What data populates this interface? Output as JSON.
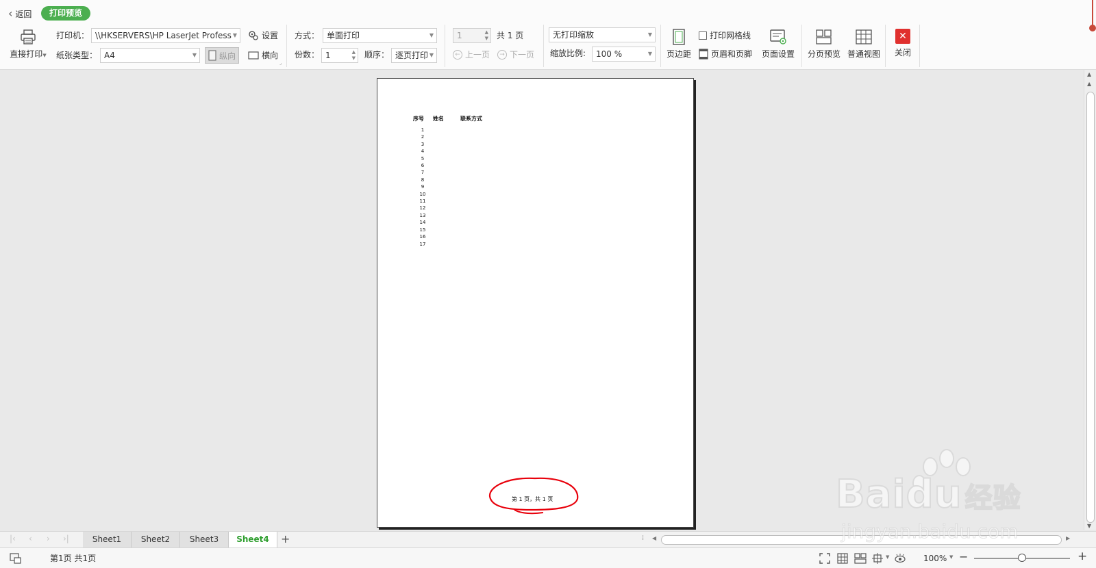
{
  "nav": {
    "back_label": "返回",
    "mode_badge": "打印预览"
  },
  "ribbon": {
    "direct_print_label": "直接打印",
    "printer_label": "打印机：",
    "printer_value": "\\\\HKSERVERS\\HP LaserJet Profess",
    "settings_label": "设置",
    "paper_type_label": "纸张类型：",
    "paper_type_value": "A4",
    "portrait_label": "纵向",
    "landscape_label": "横向",
    "method_label": "方式：",
    "method_value": "单面打印",
    "copies_label": "份数：",
    "copies_value": "1",
    "order_label": "顺序：",
    "order_value": "逐页打印",
    "page_input_value": "1",
    "total_pages_label": "共 1 页",
    "prev_page_label": "上一页",
    "next_page_label": "下一页",
    "scale_mode_value": "无打印缩放",
    "scale_ratio_label": "缩放比例:",
    "scale_ratio_value": "100 %",
    "margins_label": "页边距",
    "print_gridlines_label": "打印网格线",
    "header_footer_label": "页眉和页脚",
    "page_setup_label": "页面设置",
    "page_break_preview_label": "分页预览",
    "normal_view_label": "普通视图",
    "close_label": "关闭"
  },
  "page": {
    "headers": [
      "序号",
      "姓名",
      "联系方式"
    ],
    "row_numbers": [
      "1",
      "2",
      "3",
      "4",
      "5",
      "6",
      "7",
      "8",
      "9",
      "10",
      "11",
      "12",
      "13",
      "14",
      "15",
      "16",
      "17"
    ],
    "footer_text": "第 1 页，共 1 页"
  },
  "sheets": {
    "tabs": [
      "Sheet1",
      "Sheet2",
      "Sheet3",
      "Sheet4"
    ],
    "active": "Sheet4",
    "add_label": "+"
  },
  "status": {
    "page_info": "第1页 共1页",
    "zoom_value": "100%",
    "zoom_minus": "−",
    "zoom_plus": "+"
  },
  "watermark": {
    "brand": "Bai",
    "brand2": "du",
    "cn": "经验",
    "url": "jingyan.baidu.com"
  },
  "colors": {
    "accent": "#4caf50",
    "active_tab": "#2e9e2e",
    "close_red": "#e0302e",
    "annotation_red": "#e8000b"
  }
}
